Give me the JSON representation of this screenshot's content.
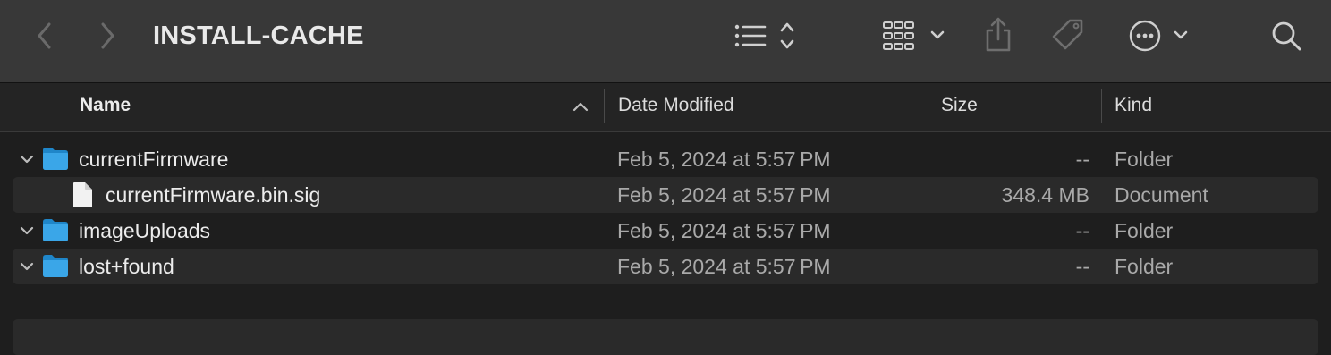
{
  "window": {
    "title": "INSTALL-CACHE"
  },
  "toolbar": {
    "back_icon": "chevron-left-icon",
    "forward_icon": "chevron-right-icon",
    "view_icon": "list-view-icon",
    "group_icon": "grid-group-icon",
    "share_icon": "share-icon",
    "tag_icon": "tag-icon",
    "action_icon": "more-actions-icon",
    "search_icon": "search-icon"
  },
  "columns": {
    "name": "Name",
    "date": "Date Modified",
    "size": "Size",
    "kind": "Kind"
  },
  "rows": [
    {
      "name": "currentFirmware",
      "date": "Feb 5, 2024 at 5:57 PM",
      "size": "--",
      "kind": "Folder",
      "type": "folder",
      "expanded": true
    },
    {
      "name": "currentFirmware.bin.sig",
      "date": "Feb 5, 2024 at 5:57 PM",
      "size": "348.4 MB",
      "kind": "Document",
      "type": "document"
    },
    {
      "name": "imageUploads",
      "date": "Feb 5, 2024 at 5:57 PM",
      "size": "--",
      "kind": "Folder",
      "type": "folder",
      "expanded": true
    },
    {
      "name": "lost+found",
      "date": "Feb 5, 2024 at 5:57 PM",
      "size": "--",
      "kind": "Folder",
      "type": "folder",
      "expanded": true
    }
  ],
  "colors": {
    "toolbar_bg": "#383838",
    "list_bg": "#1e1e1e",
    "alt_row": "#2a2a2a",
    "folder_blue": "#3aa6e8"
  }
}
